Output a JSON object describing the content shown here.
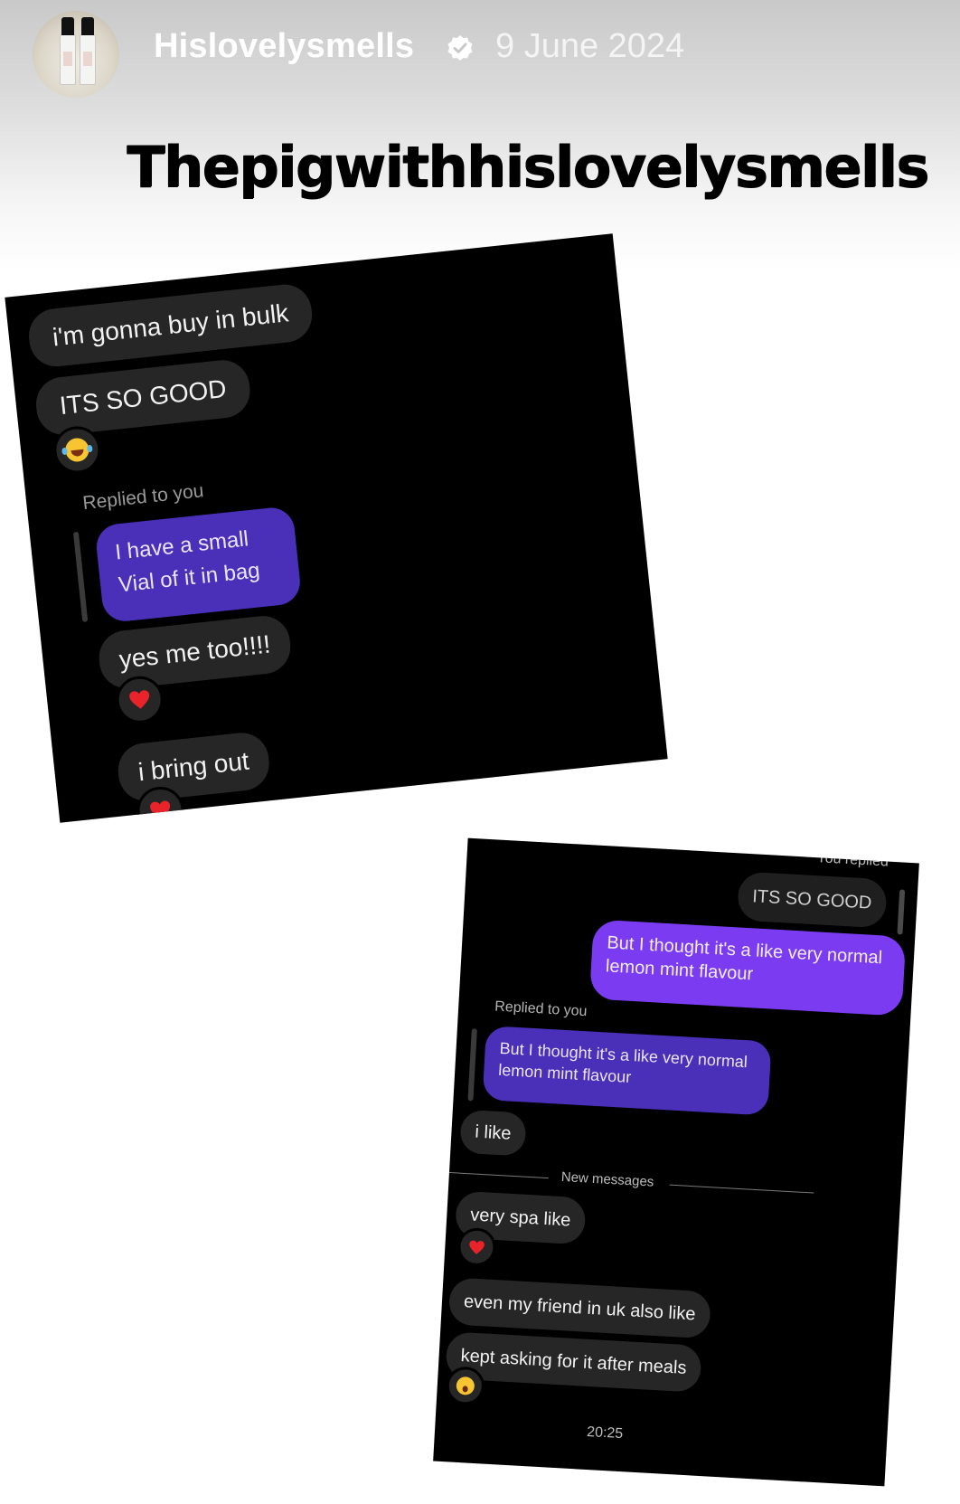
{
  "post": {
    "username": "Hislovelysmells",
    "date": "9 June 2024",
    "title": "Thepigwithhislovelysmells",
    "avatar_icon": "perfume-bottles-avatar",
    "verified_icon": "verified-badge-icon"
  },
  "screenshot1": {
    "messages": [
      {
        "text": "i'm gonna buy in bulk"
      },
      {
        "text": "ITS SO GOOD",
        "reaction": "laughing-emoji"
      },
      {
        "label": "Replied to you"
      },
      {
        "text_line1": "I have a small",
        "text_line2": "Vial of it in bag"
      },
      {
        "text": "yes me too!!!!",
        "reaction": "red-heart-emoji"
      },
      {
        "text": "i bring out",
        "reaction": "red-heart-emoji"
      }
    ]
  },
  "screenshot2": {
    "top_label": "You replied",
    "quoted": "ITS SO GOOD",
    "sent_line1": "But I thought it's a like very normal",
    "sent_line2": "lemon mint flavour",
    "replied_label": "Replied to you",
    "reply_line1": "But I thought it's a like very normal",
    "reply_line2": "lemon mint flavour",
    "messages": [
      {
        "text": "i like"
      },
      {
        "text": "very spa like",
        "reaction": "red-heart-emoji"
      },
      {
        "text": "even my friend in uk also like"
      },
      {
        "text": "kept asking for it after meals",
        "reaction": "surprised-emoji"
      }
    ],
    "divider": "New messages",
    "time": "20:25"
  }
}
